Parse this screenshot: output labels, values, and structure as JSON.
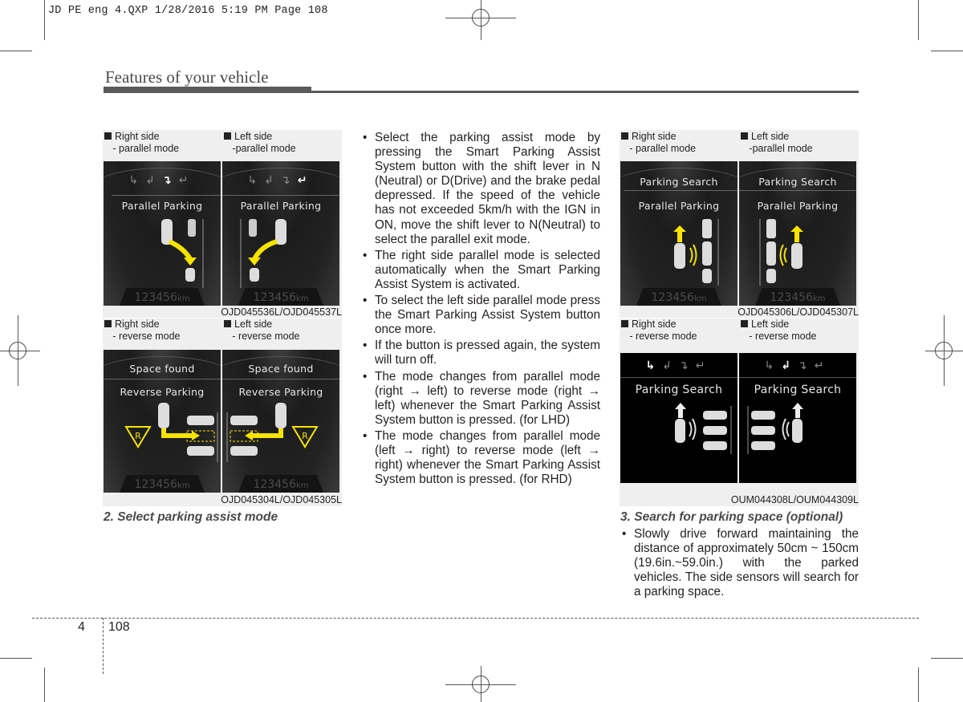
{
  "slug": "JD PE eng 4.QXP  1/28/2016  5:19 PM  Page 108",
  "section_title": "Features of your vehicle",
  "figures": {
    "fig_a": {
      "code": "OJD045536L/OJD045537L",
      "panels": [
        {
          "caption_1": "Right side",
          "caption_2": "- parallel mode",
          "screen_title": "Parallel Parking",
          "odometer": "123456",
          "odometer_unit": "km",
          "active_mode": 3
        },
        {
          "caption_1": "Left side",
          "caption_2": "-parallel mode",
          "screen_title": "Parallel Parking",
          "odometer": "123456",
          "odometer_unit": "km",
          "active_mode": 4
        }
      ]
    },
    "fig_b": {
      "code": "OJD045304L/OJD045305L",
      "panels": [
        {
          "caption_1": "Right side",
          "caption_2": "- reverse mode",
          "status": "Space found",
          "screen_title": "Reverse Parking",
          "gear_label": "R",
          "odometer": "123456",
          "odometer_unit": "km"
        },
        {
          "caption_1": "Left side",
          "caption_2": "- reverse mode",
          "status": "Space found",
          "screen_title": "Reverse Parking",
          "gear_label": "R",
          "odometer": "123456",
          "odometer_unit": "km"
        }
      ]
    },
    "fig_c": {
      "code": "OJD045306L/OJD045307L",
      "panels": [
        {
          "caption_1": "Right side",
          "caption_2": "- parallel mode",
          "status": "Parking Search",
          "screen_title": "Parallel Parking",
          "odometer": "123456",
          "odometer_unit": "km"
        },
        {
          "caption_1": "Left side",
          "caption_2": "-parallel mode",
          "status": "Parking Search",
          "screen_title": "Parallel Parking",
          "odometer": "123456",
          "odometer_unit": "km"
        }
      ]
    },
    "fig_d": {
      "code": "OUM044308L/OUM044309L",
      "panels": [
        {
          "caption_1": "Right side",
          "caption_2": "- reverse mode",
          "screen_title": "Parking Search",
          "active_mode": 1
        },
        {
          "caption_1": "Left side",
          "caption_2": "- reverse mode",
          "screen_title": "Parking Search",
          "active_mode": 2
        }
      ]
    }
  },
  "mode_icons": [
    "right-reverse-icon",
    "left-reverse-icon",
    "right-parallel-icon",
    "left-parallel-icon"
  ],
  "step2_title": "2. Select parking assist mode",
  "middle_bullets": [
    "Select the parking assist mode by pressing the Smart Parking Assist System button with the shift lever in N (Neutral) or D(Drive) and the brake pedal depressed. If the speed of the vehicle has not exceeded 5km/h with the IGN in ON, move the shift lever to N(Neutral) to select the parallel exit mode.",
    "The right side parallel mode is selected automatically when the Smart Parking Assist System is activated.",
    "To select the left side parallel mode press the Smart Parking Assist System button once more.",
    "If the button is pressed again, the system will turn off.",
    "The mode changes from parallel mode (right → left) to reverse mode (right → left) whenever the Smart Parking Assist System button is pressed. (for LHD)",
    "The mode changes from parallel mode (left → right) to reverse mode (left → right) whenever the Smart Parking Assist System button is pressed. (for RHD)"
  ],
  "step3_title": "3. Search for parking space (optional)",
  "right_bullets": [
    "Slowly drive forward maintaining the distance of approximately 50cm ~ 150cm (19.6in.~59.0in.) with the parked vehicles. The side sensors will search for a parking space."
  ],
  "footer": {
    "chapter": "4",
    "page": "108"
  },
  "colors": {
    "accent_yellow": "#f5e400",
    "screen_bg": "#1b1b1b",
    "rule": "#5a5a5a"
  }
}
